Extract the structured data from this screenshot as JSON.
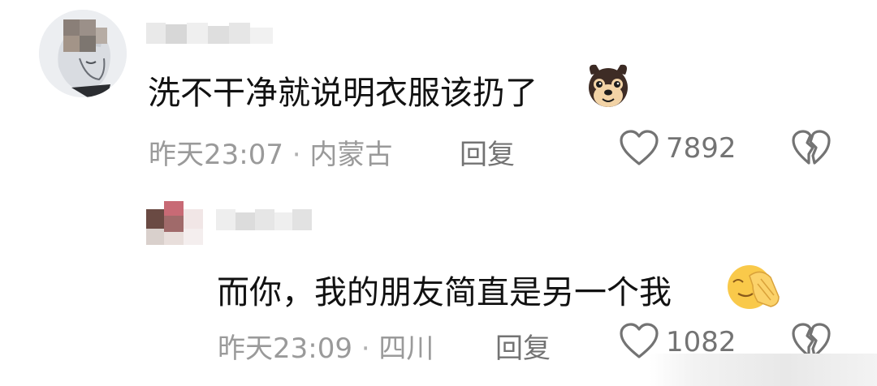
{
  "comments": [
    {
      "text": "洗不干净就说明衣服该扔了",
      "emoji": "dog-face-emoji",
      "time": "昨天23:07",
      "separator": "·",
      "location": "内蒙古",
      "reply_label": "回复",
      "likes": "7892"
    },
    {
      "text": "而你，我的朋友简直是另一个我",
      "emoji": "facepalm-emoji",
      "time": "昨天23:09",
      "separator": "·",
      "location": "四川",
      "reply_label": "回复",
      "likes": "1082"
    }
  ],
  "icons": {
    "like": "heart-outline-icon",
    "dislike": "broken-heart-icon"
  },
  "colors": {
    "text": "#111111",
    "meta": "#9a9a9a",
    "action": "#737373"
  }
}
